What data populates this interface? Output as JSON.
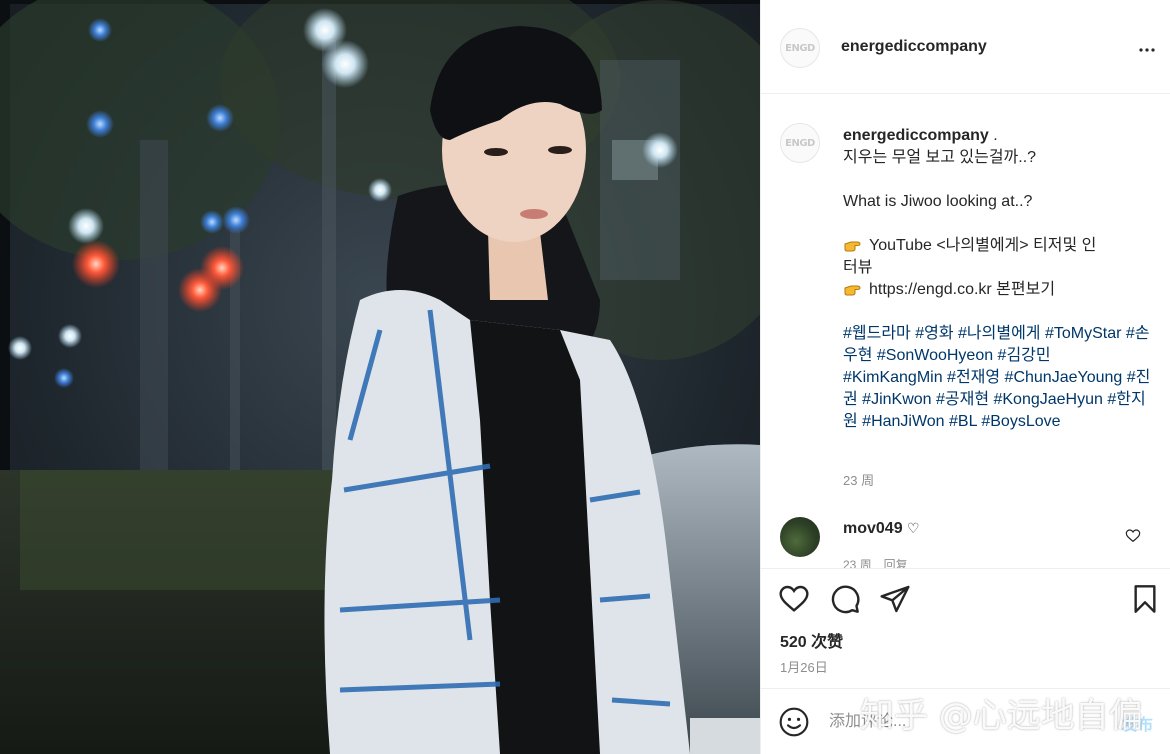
{
  "post": {
    "username": "energediccompany",
    "avatar_text": "ENGD",
    "caption": {
      "username": "energediccompany",
      "separator": " .",
      "line1": "지우는 무얼 보고 있는걸까..?",
      "line2": "What is Jiwoo looking at..?",
      "line3": "YouTube <나의별에게> 티저및 인",
      "line4": "터뷰",
      "line5": "https://engd.co.kr 본편보기",
      "hashtags": "#웹드라마 #영화 #나의별에게 #ToMyStar #손우현 #SonWooHyeon #김강민 #KimKangMin #전재영 #ChunJaeYoung #진권 #JinKwon #공재현 #KongJaeHyun #한지원 #HanJiWon #BL #BoysLove",
      "time_ago": "23 周"
    },
    "comment": {
      "username": "mov049",
      "heart": "♡",
      "meta": "23 周　回复"
    },
    "likes": "520 次赞",
    "date": "1月26日",
    "comment_bar": {
      "placeholder": "添加评论...",
      "post_label": "发布"
    },
    "watermark": "知乎 @心远地自偏"
  },
  "icons": {
    "more": "more-options-icon",
    "like": "heart-icon",
    "comment": "comment-bubble-icon",
    "share": "paper-plane-icon",
    "save": "bookmark-icon",
    "emoji": "smiley-icon",
    "hand": "pointing-hand-emoji"
  },
  "colors": {
    "hashtag": "#00376b",
    "muted": "#8e8e8e",
    "post_button": "#b2dffc"
  }
}
